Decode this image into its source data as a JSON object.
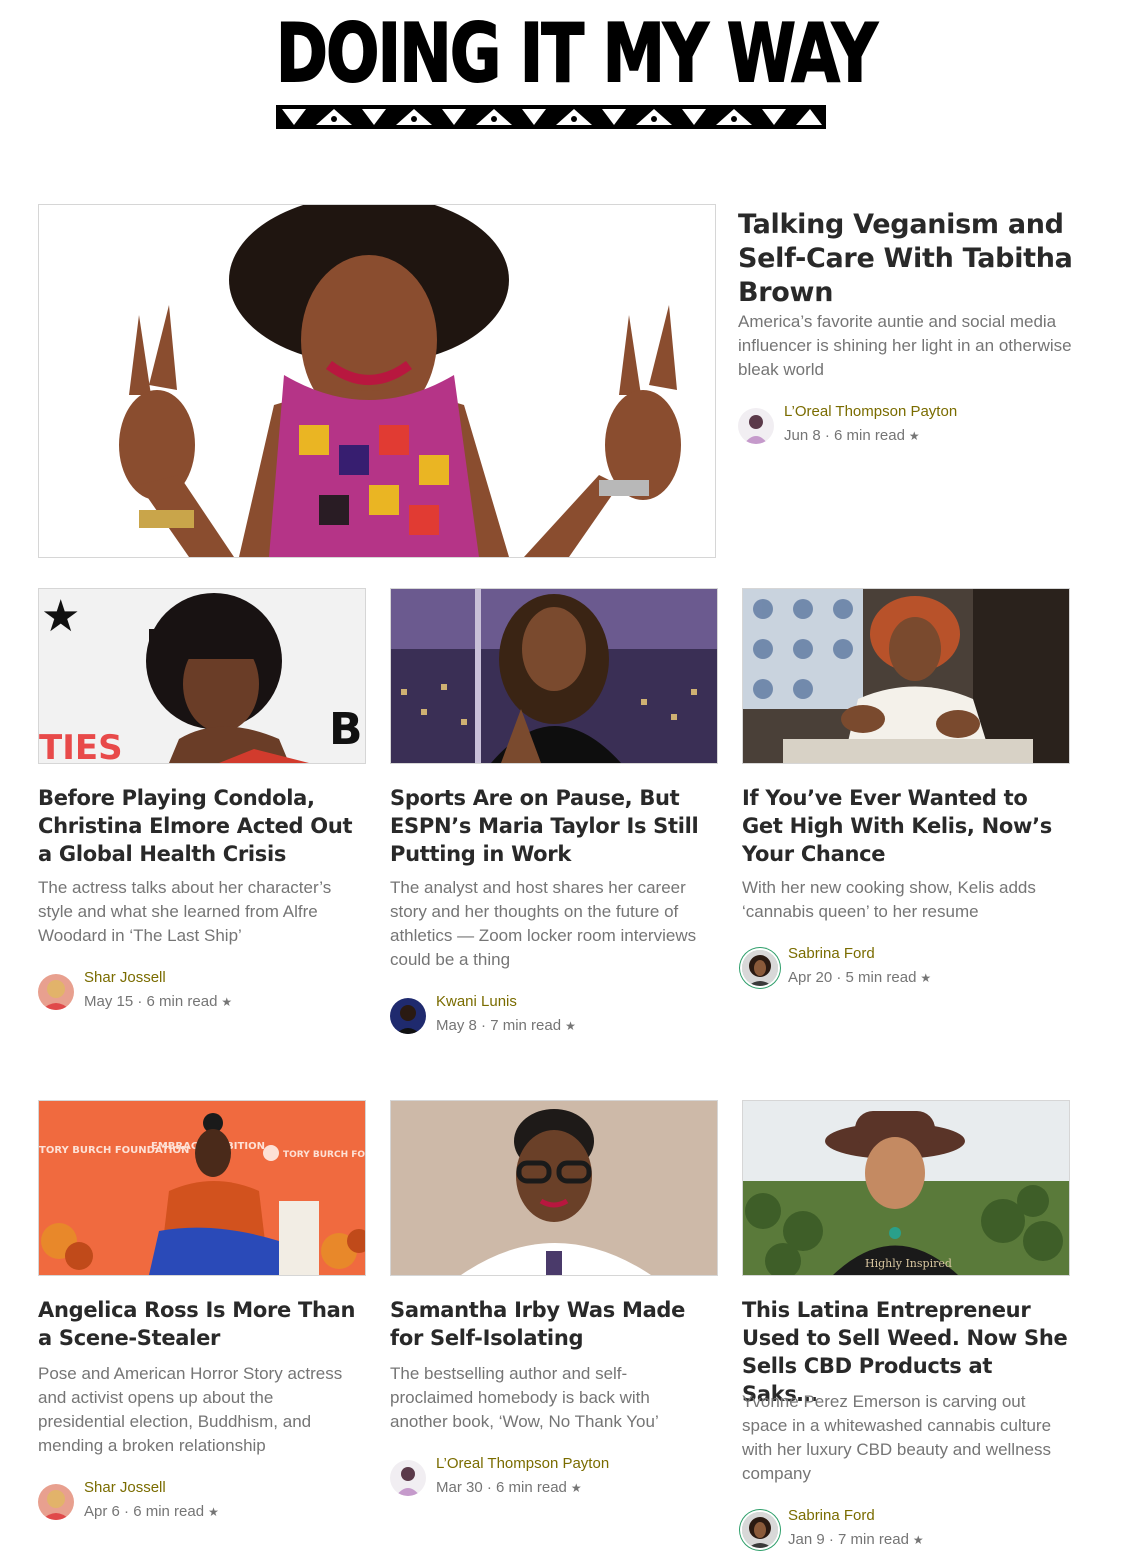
{
  "masthead": {
    "title": "DOING IT MY WAY"
  },
  "featured": {
    "title": "Talking Veganism and Self-Care With Tabitha Brown",
    "description": "America’s favorite auntie and social media influencer is shining her light in an otherwise bleak world",
    "author": "L’Oreal Thompson Payton",
    "date": "Jun 8",
    "read_time": "6 min read",
    "star_icon": "star-icon"
  },
  "stories": [
    {
      "title": "Before Playing Condola, Christina Elmore Acted Out a Global Health Crisis",
      "description": "The actress talks about her character’s style and what she learned from Alfre Woodard in ‘The Last Ship’",
      "author": "Shar Jossell",
      "date": "May 15",
      "read_time": "6 min read"
    },
    {
      "title": "Sports Are on Pause, But ESPN’s Maria Taylor Is Still Putting in Work",
      "description": "The analyst and host shares her career story and her thoughts on the future of athletics — Zoom locker room interviews could be a thing",
      "author": "Kwani Lunis",
      "date": "May 8",
      "read_time": "7 min read"
    },
    {
      "title": "If You’ve Ever Wanted to Get High With Kelis, Now’s Your Chance",
      "description": "With her new cooking show, Kelis adds ‘cannabis queen’ to her resume",
      "author": "Sabrina Ford",
      "date": "Apr 20",
      "read_time": "5 min read"
    },
    {
      "title": "Angelica Ross Is More Than a Scene-Stealer",
      "description": "Pose and American Horror Story actress and activist opens up about the presidential election, Buddhism, and mending a broken relationship",
      "author": "Shar Jossell",
      "date": "Apr 6",
      "read_time": "6 min read"
    },
    {
      "title": "Samantha Irby Was Made for Self-Isolating",
      "description": "The bestselling author and self-proclaimed homebody is back with another book, ‘Wow, No Thank You’",
      "author": "L’Oreal Thompson Payton",
      "date": "Mar 30",
      "read_time": "6 min read"
    },
    {
      "title": "This Latina Entrepreneur Used to Sell Weed. Now She Sells CBD Products at Saks…",
      "description": "Yvonne Perez Emerson is carving out space in a whitewashed cannabis culture with her luxury CBD beauty and wellness company",
      "author": "Sabrina Ford",
      "date": "Jan 9",
      "read_time": "7 min read"
    }
  ],
  "image_text": {
    "tory_burch_left": "TORY BURCH FOUNDATION",
    "embrace_ambition": "EMBRACE AMBITION",
    "tory_burch_right": "TORY BURCH FOUNDATION",
    "shirt_text": "Highly Inspired"
  },
  "colors": {
    "author_name": "#7a6c00",
    "meta": "#757575",
    "title": "#292929",
    "ring": "#2e9e6a"
  }
}
